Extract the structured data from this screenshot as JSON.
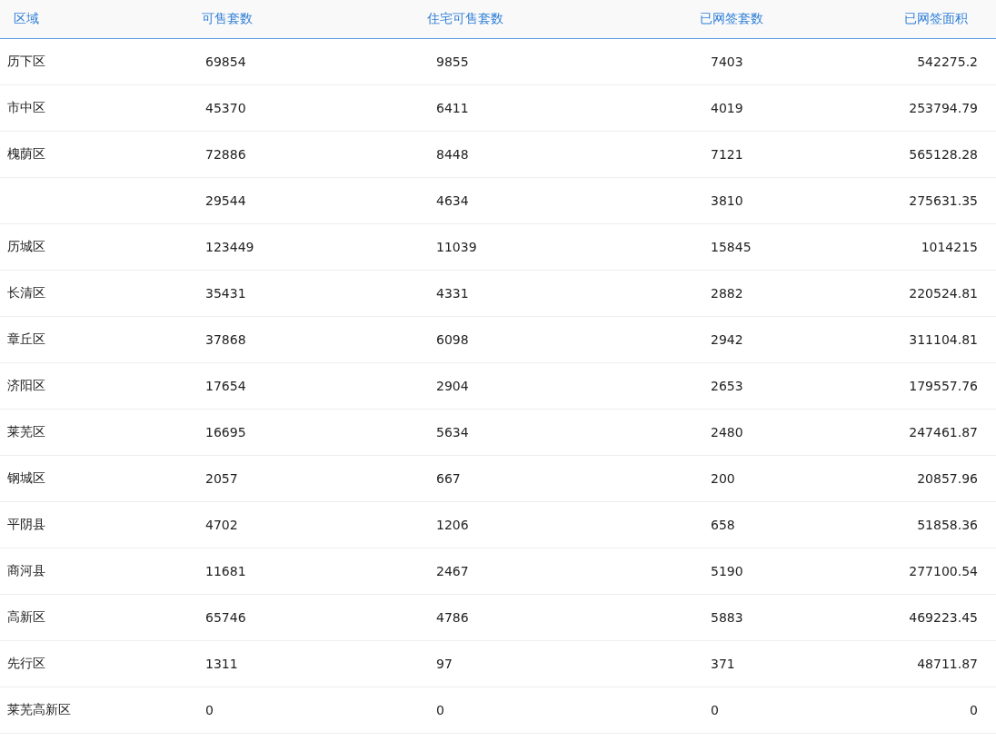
{
  "table": {
    "columns": [
      "区域",
      "可售套数",
      "住宅可售套数",
      "已网签套数",
      "已网签面积"
    ],
    "rows": [
      {
        "cells": [
          "历下区",
          "69854",
          "9855",
          "7403",
          "542275.2"
        ]
      },
      {
        "cells": [
          "市中区",
          "45370",
          "6411",
          "4019",
          "253794.79"
        ]
      },
      {
        "cells": [
          "槐荫区",
          "72886",
          "8448",
          "7121",
          "565128.28"
        ]
      },
      {
        "cells": [
          "",
          "29544",
          "4634",
          "3810",
          "275631.35"
        ]
      },
      {
        "cells": [
          "历城区",
          "123449",
          "11039",
          "15845",
          "1014215"
        ]
      },
      {
        "cells": [
          "长清区",
          "35431",
          "4331",
          "2882",
          "220524.81"
        ]
      },
      {
        "cells": [
          "章丘区",
          "37868",
          "6098",
          "2942",
          "311104.81"
        ]
      },
      {
        "cells": [
          "济阳区",
          "17654",
          "2904",
          "2653",
          "179557.76"
        ]
      },
      {
        "cells": [
          "莱芜区",
          "16695",
          "5634",
          "2480",
          "247461.87"
        ]
      },
      {
        "cells": [
          "钢城区",
          "2057",
          "667",
          "200",
          "20857.96"
        ]
      },
      {
        "cells": [
          "平阴县",
          "4702",
          "1206",
          "658",
          "51858.36"
        ]
      },
      {
        "cells": [
          "商河县",
          "11681",
          "2467",
          "5190",
          "277100.54"
        ]
      },
      {
        "cells": [
          "高新区",
          "65746",
          "4786",
          "5883",
          "469223.45"
        ]
      },
      {
        "cells": [
          "先行区",
          "1311",
          "97",
          "371",
          "48711.87"
        ]
      },
      {
        "cells": [
          "莱芜高新区",
          "0",
          "0",
          "0",
          "0"
        ]
      }
    ]
  }
}
